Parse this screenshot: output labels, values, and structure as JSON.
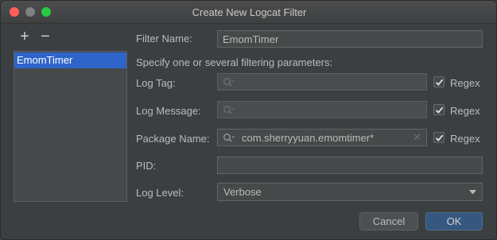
{
  "window": {
    "title": "Create New Logcat Filter"
  },
  "toolbar": {
    "add_label": "+",
    "remove_label": "−"
  },
  "filters_list": {
    "items": [
      "EmomTimer"
    ]
  },
  "form": {
    "filter_name": {
      "label": "Filter Name:",
      "value": "EmomTimer"
    },
    "hint": "Specify one or several filtering parameters:",
    "log_tag": {
      "label": "Log Tag:",
      "value": "",
      "regex_label": "Regex",
      "regex_checked": true
    },
    "log_message": {
      "label": "Log Message:",
      "value": "",
      "regex_label": "Regex",
      "regex_checked": true
    },
    "package_name": {
      "label": "Package Name:",
      "value": "com.sherryyuan.emomtimer*",
      "regex_label": "Regex",
      "regex_checked": true
    },
    "pid": {
      "label": "PID:",
      "value": ""
    },
    "log_level": {
      "label": "Log Level:",
      "selected": "Verbose"
    }
  },
  "buttons": {
    "cancel": "Cancel",
    "ok": "OK"
  },
  "colors": {
    "selection": "#2f65ca",
    "ok_button": "#365880",
    "background": "#3c3f41"
  },
  "icons": {
    "search": "search-icon",
    "clear": "clear-icon",
    "dropdown": "chevron-down-icon",
    "check": "check-icon"
  }
}
